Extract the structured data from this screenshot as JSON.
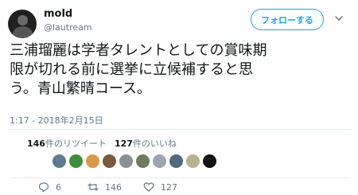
{
  "tweet": {
    "author": {
      "name": "mold",
      "handle": "@lautream"
    },
    "follow_label": "フォローする",
    "text": "三浦瑠麗は学者タレントとしての賞味期\n限が切れる前に選挙に立候補すると思\nう。青山繁晴コース。",
    "timestamp": "1:17 - 2018年2月15日",
    "stats": {
      "retweets_count": "146",
      "retweets_label": "件のリツイート",
      "likes_count": "127",
      "likes_label": "件のいいね"
    },
    "likers": [
      {
        "icon": "liker-avatar",
        "color": "#5e7a91"
      },
      {
        "icon": "liker-avatar",
        "color": "#3f8f3a"
      },
      {
        "icon": "liker-avatar",
        "color": "#d89a4a"
      },
      {
        "icon": "liker-avatar",
        "color": "#7a5a3a"
      },
      {
        "icon": "liker-avatar",
        "color": "#8a8f94"
      },
      {
        "icon": "liker-avatar",
        "color": "#6e7b5e"
      },
      {
        "icon": "liker-avatar",
        "color": "#9aa7b3"
      },
      {
        "icon": "liker-avatar",
        "color": "#4f6a7a"
      },
      {
        "icon": "liker-avatar",
        "color": "#b8b090"
      },
      {
        "icon": "liker-avatar",
        "color": "#111111"
      }
    ],
    "actions": {
      "reply_count": "6",
      "retweet_count": "146",
      "like_count": "127"
    }
  },
  "colors": {
    "accent": "#1da1f2",
    "muted": "#657786",
    "text": "#14171a"
  }
}
